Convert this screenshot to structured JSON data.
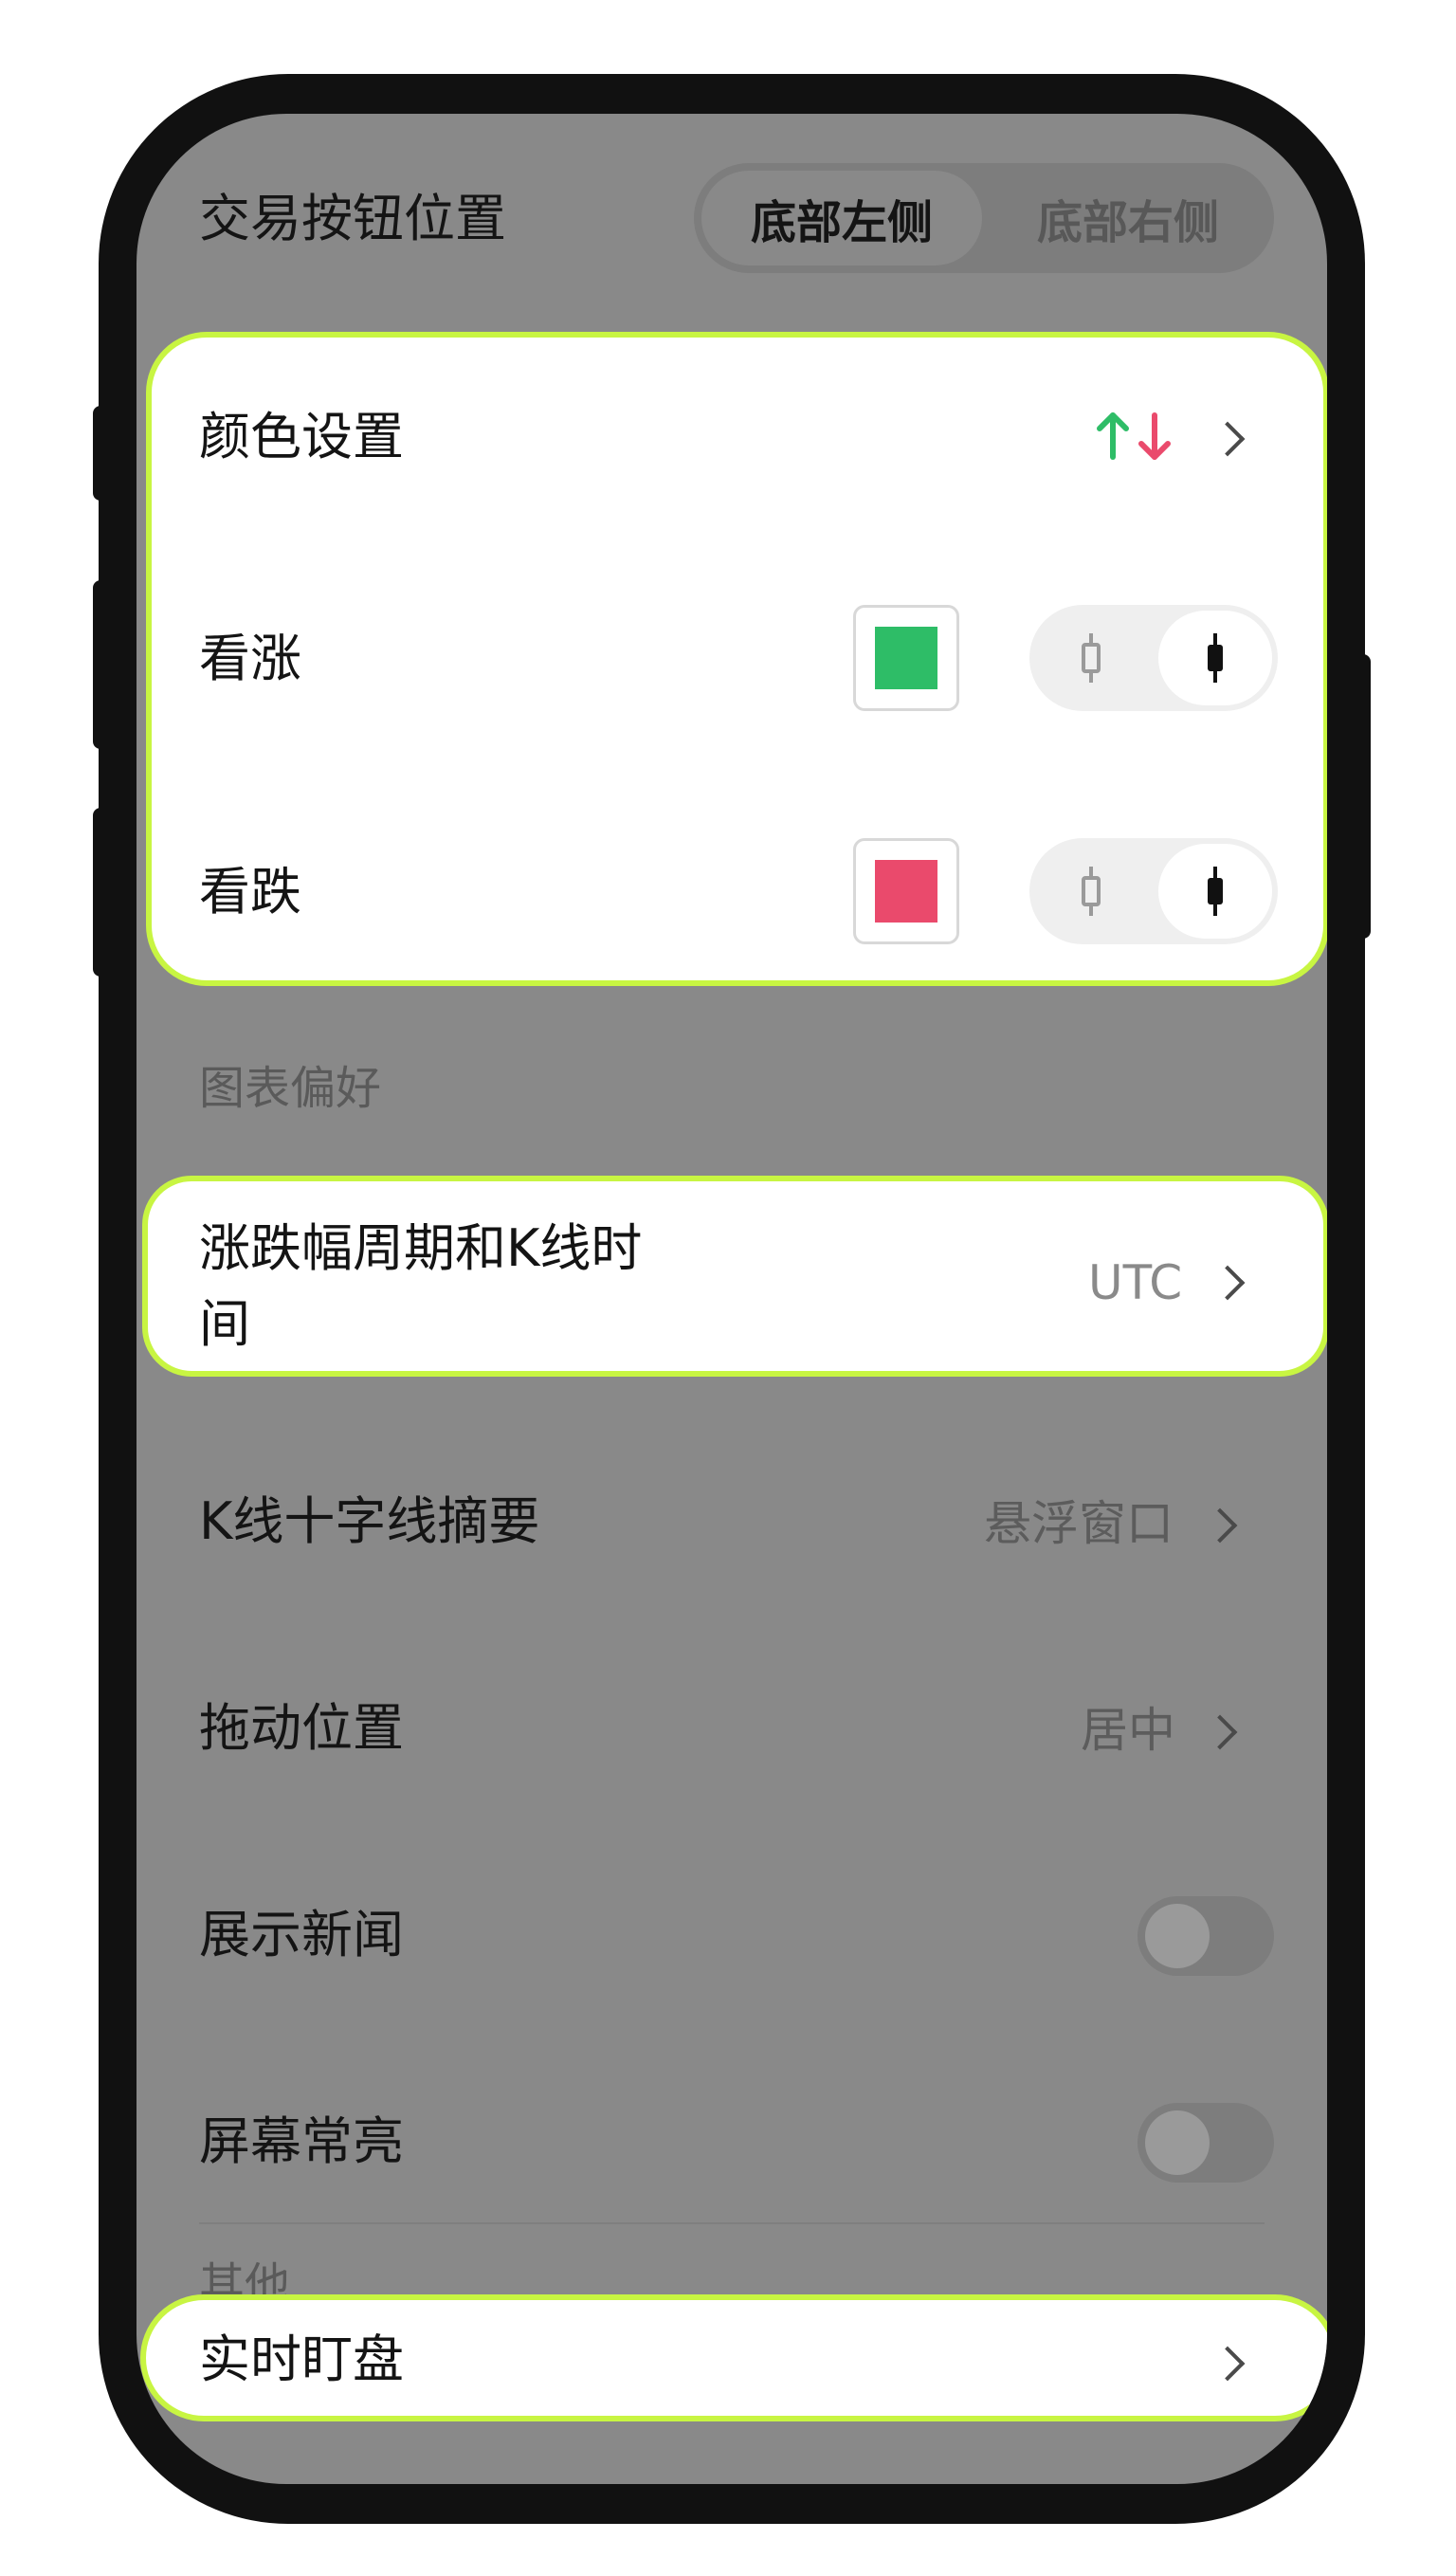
{
  "trade_button": {
    "label": "交易按钮位置",
    "options": [
      "底部左侧",
      "底部右侧"
    ],
    "selected": "底部左侧"
  },
  "color_settings": {
    "label": "颜色设置",
    "bullish": {
      "label": "看涨",
      "color": "#2ebd67"
    },
    "bearish": {
      "label": "看跌",
      "color": "#ea4a6c"
    }
  },
  "chart_prefs": {
    "section_label": "图表偏好",
    "period": {
      "label_line1": "涨跌幅周期和K线时",
      "label_line2": "间",
      "value": "UTC"
    },
    "crosshair": {
      "label": "K线十字线摘要",
      "value": "悬浮窗口"
    },
    "drag": {
      "label": "拖动位置",
      "value": "居中"
    },
    "news": {
      "label": "展示新闻",
      "enabled": false
    },
    "screen_on": {
      "label": "屏幕常亮",
      "enabled": false
    }
  },
  "other": {
    "section_label": "其他",
    "watch": {
      "label": "实时盯盘"
    }
  },
  "colors": {
    "up": "#2ebd67",
    "down": "#ea4a6c",
    "highlight": "#c8f542"
  }
}
